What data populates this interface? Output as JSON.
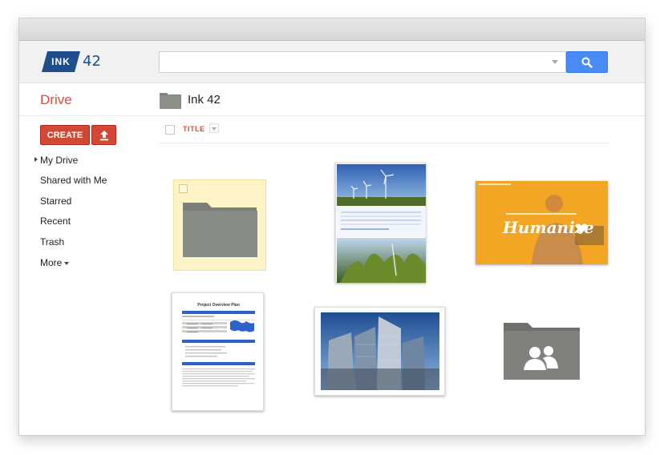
{
  "logo": {
    "brand": "INK",
    "number": "42"
  },
  "search": {
    "value": "",
    "placeholder": ""
  },
  "header": {
    "app_title": "Drive",
    "breadcrumb": "Ink 42"
  },
  "actions": {
    "create_label": "CREATE"
  },
  "sidebar": {
    "items": [
      {
        "label": "My Drive",
        "selected": true
      },
      {
        "label": "Shared with Me"
      },
      {
        "label": "Starred"
      },
      {
        "label": "Recent"
      },
      {
        "label": "Trash"
      },
      {
        "label": "More"
      }
    ]
  },
  "list": {
    "title_column": "TITLE"
  },
  "files": {
    "humanize_caption": "Humanize",
    "document_title": "Project Overview Plan"
  },
  "colors": {
    "accent_red": "#dd4b39",
    "search_blue": "#4a8af4",
    "logo_blue": "#1f4e8c",
    "humanize_orange": "#f2a623"
  }
}
